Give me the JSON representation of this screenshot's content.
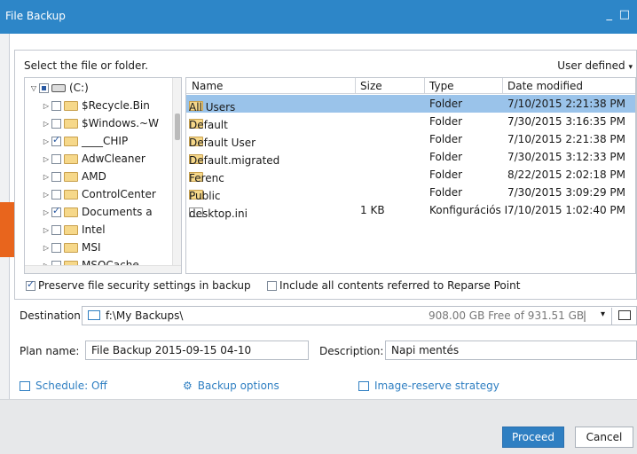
{
  "window": {
    "title": "File Backup",
    "minimize_glyph": "_",
    "maximize_glyph": "□"
  },
  "panel": {
    "heading": "Select the file or folder.",
    "view_mode": "User defined"
  },
  "tree": {
    "root": {
      "label": "(C:)",
      "state": "partial"
    },
    "items": [
      {
        "label": "$Recycle.Bin",
        "checked": false
      },
      {
        "label": "$Windows.~W",
        "checked": false
      },
      {
        "label": "____CHIP",
        "checked": true
      },
      {
        "label": "AdwCleaner",
        "checked": false
      },
      {
        "label": "AMD",
        "checked": false
      },
      {
        "label": "ControlCenter",
        "checked": false
      },
      {
        "label": "Documents a",
        "checked": true
      },
      {
        "label": "Intel",
        "checked": false
      },
      {
        "label": "MSI",
        "checked": false
      },
      {
        "label": "MSOCache",
        "checked": false
      }
    ]
  },
  "files": {
    "columns": {
      "name": "Name",
      "size": "Size",
      "type": "Type",
      "date": "Date modified"
    },
    "rows": [
      {
        "name": "All Users",
        "size": "",
        "type": "Folder",
        "date": "7/10/2015 2:21:38  PM",
        "state": "checked",
        "selected": true,
        "icon": "folder-icon"
      },
      {
        "name": "Default",
        "size": "",
        "type": "Folder",
        "date": "7/30/2015 3:16:35  PM",
        "state": "unchecked",
        "selected": false,
        "icon": "folder-icon"
      },
      {
        "name": "Default User",
        "size": "",
        "type": "Folder",
        "date": "7/10/2015 2:21:38  PM",
        "state": "unchecked",
        "selected": false,
        "icon": "folder-icon"
      },
      {
        "name": "Default.migrated",
        "size": "",
        "type": "Folder",
        "date": "7/30/2015 3:12:33  PM",
        "state": "unchecked",
        "selected": false,
        "icon": "folder-icon"
      },
      {
        "name": "Ferenc",
        "size": "",
        "type": "Folder",
        "date": "8/22/2015 2:02:18  PM",
        "state": "partial",
        "selected": false,
        "icon": "folder-icon"
      },
      {
        "name": "Public",
        "size": "",
        "type": "Folder",
        "date": "7/30/2015 3:09:29  PM",
        "state": "unchecked",
        "selected": false,
        "icon": "folder-icon"
      },
      {
        "name": "desktop.ini",
        "size": "1 KB",
        "type": "Konfigurációs I",
        "date": "7/10/2015 1:02:40  PM",
        "state": "unchecked",
        "selected": false,
        "icon": "settings-file-icon"
      }
    ]
  },
  "options": {
    "preserve_security": {
      "label": "Preserve file security settings in backup",
      "checked": true
    },
    "reparse_point": {
      "label": "Include all contents referred to Reparse Point",
      "checked": false
    }
  },
  "destination": {
    "label": "Destination:",
    "path": "f:\\My Backups\\",
    "free_space": "908.00 GB Free of 931.51 GB"
  },
  "plan": {
    "name_label": "Plan name:",
    "name_value": "File Backup 2015-09-15 04-10",
    "description_label": "Description:",
    "description_value": "Napi mentés"
  },
  "links": {
    "schedule": "Schedule: Off",
    "backup_options": "Backup options",
    "image_reserve": "Image-reserve strategy"
  },
  "buttons": {
    "proceed": "Proceed",
    "cancel": "Cancel"
  },
  "colors": {
    "titlebar": "#2d86c8",
    "accent": "#2f7fc2",
    "selection": "#9ac3ea",
    "orange_tab": "#e8651d"
  }
}
